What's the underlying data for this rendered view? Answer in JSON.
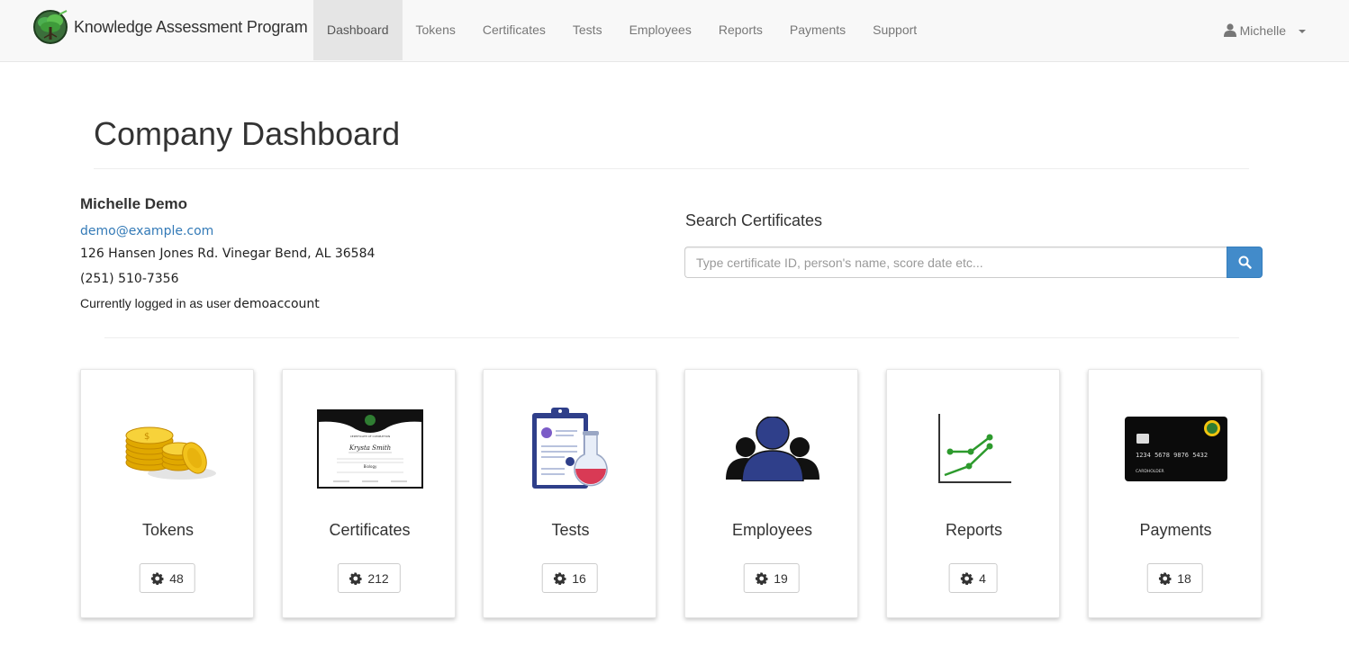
{
  "brand": {
    "name": "Knowledge Assessment Program",
    "icon": "tree-logo-icon"
  },
  "nav": {
    "items": [
      {
        "label": "Dashboard",
        "active": true
      },
      {
        "label": "Tokens",
        "active": false
      },
      {
        "label": "Certificates",
        "active": false
      },
      {
        "label": "Tests",
        "active": false
      },
      {
        "label": "Employees",
        "active": false
      },
      {
        "label": "Reports",
        "active": false
      },
      {
        "label": "Payments",
        "active": false
      },
      {
        "label": "Support",
        "active": false
      }
    ],
    "user": {
      "name": "Michelle",
      "icon": "user-icon"
    }
  },
  "page": {
    "title": "Company Dashboard"
  },
  "profile": {
    "name": "Michelle Demo",
    "email": "demo@example.com",
    "address": "126 Hansen Jones Rd. Vinegar Bend, AL 36584",
    "phone": "(251) 510-7356",
    "login_prefix": "Currently logged in as user",
    "username": "demoaccount"
  },
  "search": {
    "heading": "Search Certificates",
    "placeholder": "Type certificate ID, person's name, score date etc...",
    "value": "",
    "button_icon": "search-icon"
  },
  "cards": [
    {
      "title": "Tokens",
      "count": "48",
      "icon": "gold-coins-icon"
    },
    {
      "title": "Certificates",
      "count": "212",
      "icon": "certificate-icon"
    },
    {
      "title": "Tests",
      "count": "16",
      "icon": "clipboard-flask-icon"
    },
    {
      "title": "Employees",
      "count": "19",
      "icon": "people-group-icon"
    },
    {
      "title": "Reports",
      "count": "4",
      "icon": "line-chart-icon"
    },
    {
      "title": "Payments",
      "count": "18",
      "icon": "credit-card-icon"
    }
  ],
  "certificate_art": {
    "recipient": "Krysta Smith",
    "subject": "Biology"
  },
  "card_art": {
    "number": "1234 5678 9876 5432",
    "holder": "CARDHOLDER"
  },
  "colors": {
    "link": "#337ab7",
    "search_button": "#428bca",
    "nav_active_bg": "#e5e5e5",
    "navbar_bg": "#f8f8f8",
    "employees_icon": "#2f3f8a",
    "reports_line": "#2d9a2d",
    "coins": "#f2c21b"
  }
}
